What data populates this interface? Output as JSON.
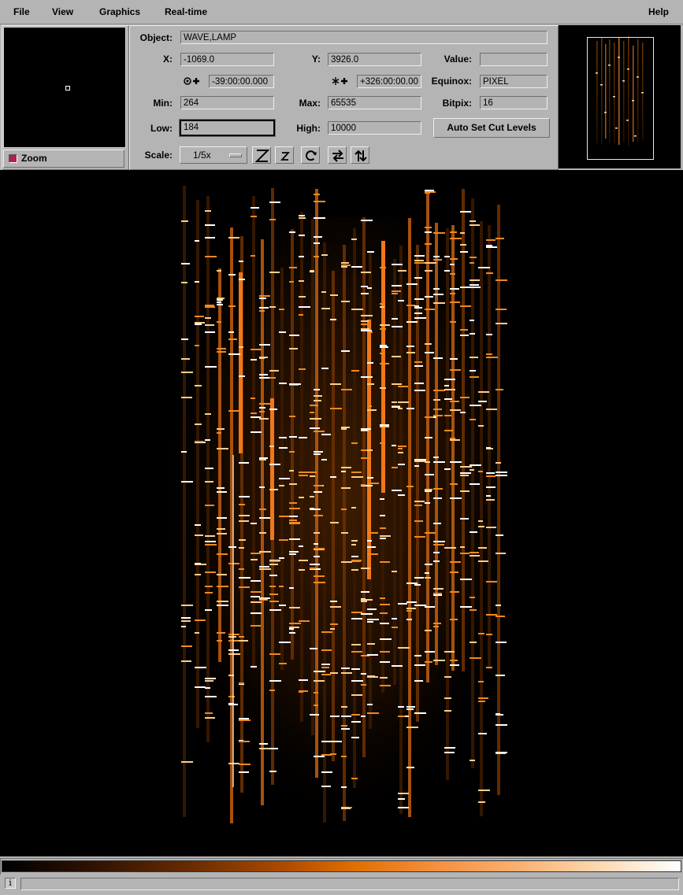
{
  "menu": {
    "file": "File",
    "view": "View",
    "graphics": "Graphics",
    "realtime": "Real-time",
    "help": "Help"
  },
  "zoom": {
    "label": "Zoom",
    "checked": true
  },
  "info": {
    "object_label": "Object:",
    "object_value": "WAVE,LAMP",
    "x_label": "X:",
    "x_value": "-1069.0",
    "y_label": "Y:",
    "y_value": "3926.0",
    "value_label": "Value:",
    "value_value": "",
    "ra_value": "-39:00:00.000",
    "dec_value": "+326:00:00.00",
    "equinox_label": "Equinox:",
    "equinox_value": "PIXEL",
    "min_label": "Min:",
    "min_value": "264",
    "max_label": "Max:",
    "max_value": "65535",
    "bitpix_label": "Bitpix:",
    "bitpix_value": "16",
    "low_label": "Low:",
    "low_value": "184",
    "high_label": "High:",
    "high_value": "10000",
    "auto_cut_label": "Auto Set Cut Levels",
    "scale_label": "Scale:",
    "scale_value": "1/5x"
  },
  "toolbar_icons": [
    "zoom-in-icon",
    "zoom-out-icon",
    "rotate-icon",
    "flip-x-icon",
    "flip-y-icon"
  ],
  "colors": {
    "background": "#b4b4b4",
    "colormap_mid": "#e07000",
    "colormap_high": "#ffffff",
    "zoom_check": "#b02050"
  },
  "status": {
    "message": ""
  }
}
